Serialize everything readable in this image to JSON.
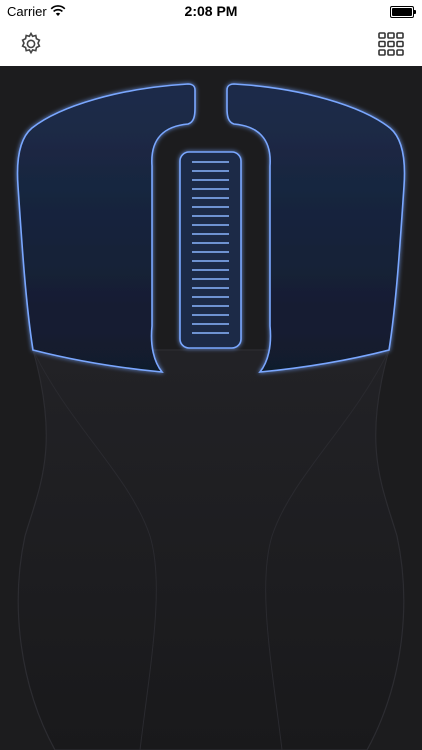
{
  "status_bar": {
    "carrier": "Carrier",
    "time": "2:08 PM"
  },
  "nav_bar": {
    "left_icon": "gear-icon",
    "right_icon": "grid-icon"
  },
  "mouse": {
    "buttons": [
      "left-mouse-button",
      "right-mouse-button"
    ],
    "scroll_wheel": "scroll-wheel",
    "accent_color": "#7aa7ff",
    "button_fill": "#152037"
  }
}
